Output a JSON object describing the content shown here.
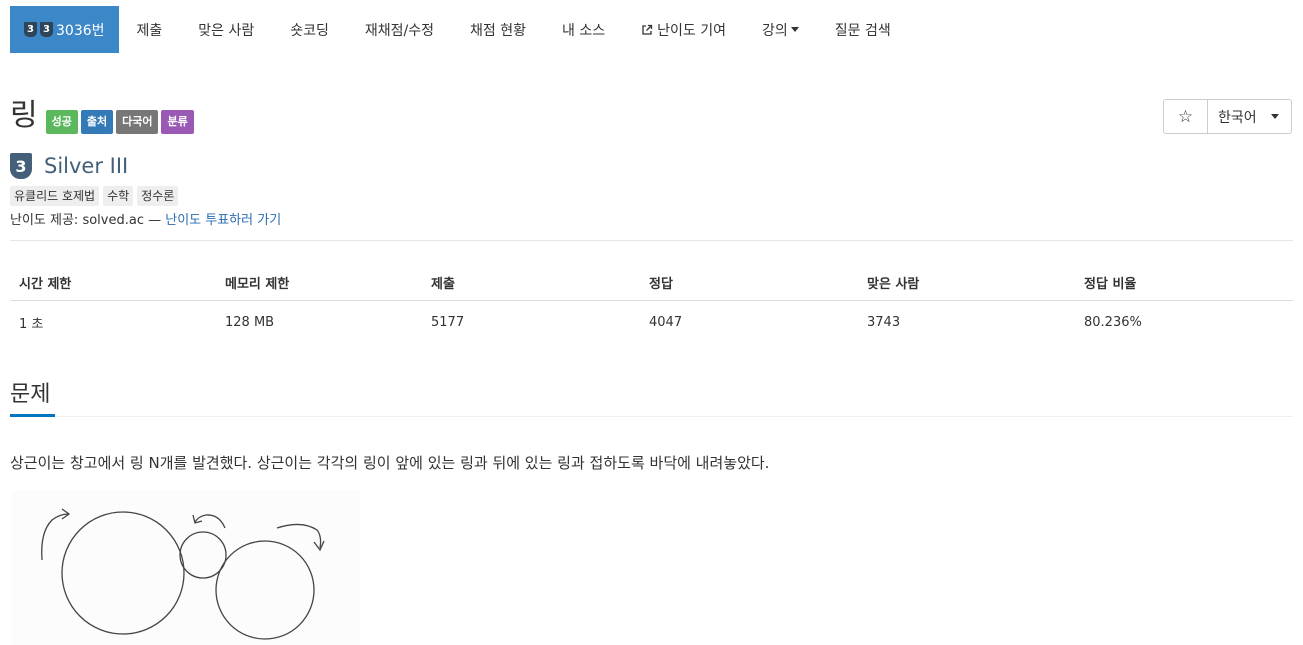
{
  "nav": {
    "problem_id": "3036번",
    "tier_icons": [
      "3",
      "3"
    ],
    "items": [
      "제출",
      "맞은 사람",
      "숏코딩",
      "재채점/수정",
      "채점 현황",
      "내 소스",
      "난이도 기여",
      "강의",
      "질문 검색"
    ]
  },
  "problem": {
    "title": "링",
    "labels": [
      "성공",
      "출처",
      "다국어",
      "분류"
    ],
    "tier_number": "3",
    "tier_name": "Silver III",
    "tags": [
      "유클리드 호제법",
      "수학",
      "정수론"
    ],
    "provider_prefix": "난이도 제공: solved.ac —",
    "provider_link": "난이도 투표하러 가기"
  },
  "actions": {
    "star": "☆",
    "language": "한국어"
  },
  "info_table": {
    "headers": [
      "시간 제한",
      "메모리 제한",
      "제출",
      "정답",
      "맞은 사람",
      "정답 비율"
    ],
    "row": [
      "1 초",
      "128 MB",
      "5177",
      "4047",
      "3743",
      "80.236%"
    ]
  },
  "section": {
    "title": "문제",
    "description": "상근이는 창고에서 링 N개를 발견했다. 상근이는 각각의 링이 앞에 있는 링과 뒤에 있는 링과 접하도록 바닥에 내려놓았다."
  },
  "colors": {
    "primary": "#3c87c8",
    "silver_tier": "#435f7a",
    "success": "#5cb85c",
    "source": "#337ab7",
    "multilang": "#777777",
    "category": "#9b59b6",
    "link": "#2a6cb0"
  }
}
